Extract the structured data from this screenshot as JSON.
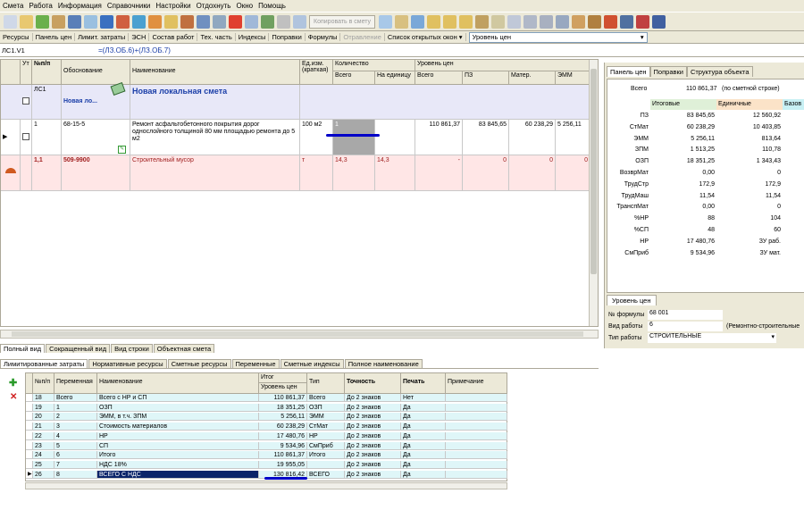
{
  "menu": [
    "Смета",
    "Работа",
    "Информация",
    "Справочники",
    "Настройки",
    "Отдохнуть",
    "Окно",
    "Помощь"
  ],
  "toolbar": {
    "copy_button": "Копировать в смету"
  },
  "toolbar2": {
    "items": [
      "Ресурсы",
      "Панель цен",
      "Лимит. затраты",
      "ЭСН",
      "Состав работ",
      "Тех. часть",
      "Индексы",
      "Поправки",
      "Формулы"
    ],
    "disabled_item": "Отравление",
    "open_windows": "Список открытых окон ▾",
    "price_level": "Уровень цен"
  },
  "formula_bar": {
    "cell": "ЛС1.V1",
    "formula": "=(ЛЗ.ОБ.6)+(ЛЗ.ОБ.7)"
  },
  "grid": {
    "headers": {
      "ut": "Ут",
      "num": "№п/п",
      "basis": "Обоснование",
      "name": "Наименование",
      "unit": "Ед.изм. (краткая)",
      "qty": "Количество",
      "qty_total": "Всего",
      "qty_unit": "На единицу",
      "price_level": "Уровень цен",
      "pl_total": "Всего",
      "pl_pz": "ПЗ",
      "pl_mat": "Матер.",
      "pl_emm": "ЭММ"
    },
    "row1": {
      "num": "ЛС1",
      "title": "Новая локальная смета",
      "short": "Новая ло..."
    },
    "row2": {
      "num": "1",
      "basis": "68-15-5",
      "name": "Ремонт асфальтобетонного покрытия дорог однослойного толщиной 80 мм площадью ремонта до 5 м2",
      "unit": "100 м2",
      "qty": "1",
      "total": "110 861,37",
      "pz": "83 845,65",
      "mat": "60 238,29",
      "emm": "5 256,11"
    },
    "row3": {
      "num": "1,1",
      "basis": "509-9900",
      "name": "Строительный мусор",
      "unit": "т",
      "qty": "14,3",
      "qty_unit": "14,3",
      "total": "-",
      "pz": "0",
      "mat": "0",
      "emm": "0"
    }
  },
  "view_tabs": [
    "Полный вид",
    "Сокращенный вид",
    "Вид строки",
    "Объектная смета"
  ],
  "right_panel": {
    "tabs": [
      "Панель цен",
      "Поправки",
      "Структура объекта"
    ],
    "total_label": "Всего",
    "total_value": "110 861,37",
    "total_note": "(по сметной строке)",
    "col_headers": [
      "Итоговые",
      "Единичные",
      "Базов"
    ],
    "rows": [
      [
        "ПЗ",
        "83 845,65",
        "12 560,92"
      ],
      [
        "СтМат",
        "60 238,29",
        "10 403,85"
      ],
      [
        "ЭММ",
        "5 256,11",
        "813,64"
      ],
      [
        "ЗПМ",
        "1 513,25",
        "110,78"
      ],
      [
        "ОЗП",
        "18 351,25",
        "1 343,43"
      ],
      [
        "ВозврМат",
        "0,00",
        "0"
      ],
      [
        "ТрудСтр",
        "172,9",
        "172,9"
      ],
      [
        "ТрудМаш",
        "11,54",
        "11,54"
      ],
      [
        "ТранспМат",
        "0,00",
        "0"
      ],
      [
        "%НР",
        "88",
        "104"
      ],
      [
        "%СП",
        "48",
        "60"
      ],
      [
        "НР",
        "17 480,76",
        "ЗУ раб."
      ],
      [
        "СмПриб",
        "9 534,96",
        "ЗУ мат."
      ]
    ],
    "bottom_tab": "Уровень цен",
    "formula_no_label": "№ формулы",
    "formula_no": "68 001",
    "work_type_label": "Вид работы",
    "work_type": "6",
    "work_type_note": "(Ремонтно-строительные",
    "work_kind_label": "Тип работы",
    "work_kind": "СТРОИТЕЛЬНЫЕ"
  },
  "bottom_tabs": [
    "Лимитированные затраты",
    "Нормативные ресурсы",
    "Сметные ресурсы",
    "Переменные",
    "Сметные индексы",
    "Полное наименование"
  ],
  "bottom_grid": {
    "headers": {
      "num": "№п/п",
      "var": "Переменная",
      "name": "Наименование",
      "total": "Итог",
      "price_level": "Уровень цен",
      "type": "Тип",
      "precision": "Точность",
      "print": "Печать",
      "note": "Примечание"
    },
    "rows": [
      [
        "18",
        "Всего",
        "Всего с НР и СП",
        "110 861,37",
        "Всего",
        "До 2 знаков",
        "Нет"
      ],
      [
        "19",
        "1",
        "ОЗП",
        "18 351,25",
        "ОЗП",
        "До 2 знаков",
        "Да"
      ],
      [
        "20",
        "2",
        "ЭММ, в т.ч. ЗПМ",
        "5 256,11",
        "ЭММ",
        "До 2 знаков",
        "Да"
      ],
      [
        "21",
        "3",
        "Стоимость материалов",
        "60 238,29",
        "СтМат",
        "До 2 знаков",
        "Да"
      ],
      [
        "22",
        "4",
        "НР",
        "17 480,76",
        "НР",
        "До 2 знаков",
        "Да"
      ],
      [
        "23",
        "5",
        "СП",
        "9 534,96",
        "СмПриб",
        "До 2 знаков",
        "Да"
      ],
      [
        "24",
        "6",
        "Итого",
        "110 861,37",
        "Итого",
        "До 2 знаков",
        "Да"
      ],
      [
        "25",
        "7",
        "НДС 18%",
        "19 955,05",
        "",
        "До 2 знаков",
        "Да"
      ],
      [
        "26",
        "8",
        "ВСЕГО С НДС",
        "130 816,42",
        "ВСЕГО",
        "До 2 знаков",
        "Да"
      ]
    ]
  },
  "colors": {
    "accent": "#0a246a",
    "pink": "#ffe6e6",
    "cyan": "#dff6f8",
    "lavender": "#e8e8f8"
  }
}
